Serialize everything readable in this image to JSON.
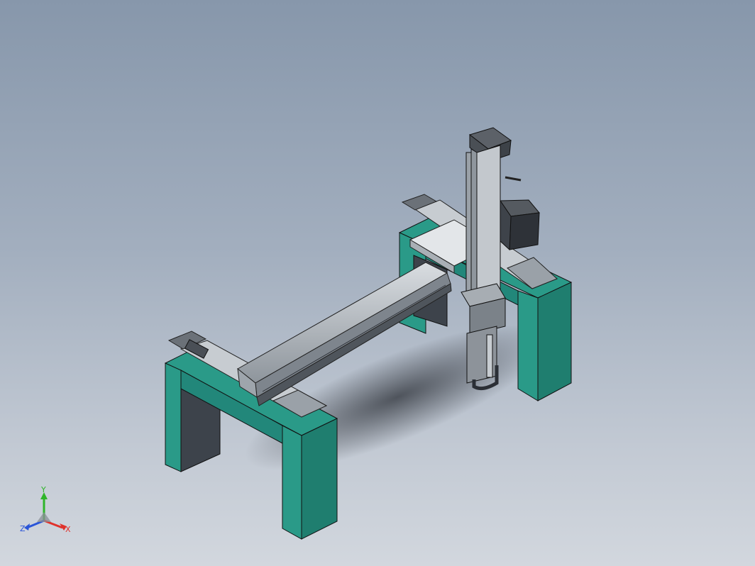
{
  "viewport": {
    "background_top": "#8797ab",
    "background_bottom": "#d2d7de"
  },
  "colors": {
    "support_face": "#2a9a88",
    "support_face_dark": "#1f7e6f",
    "support_inner": "#3d434b",
    "rail_metal": "#b7bcc2",
    "rail_shadow": "#5b6168",
    "motor_dark": "#2e3238",
    "axis_x": "#e0322b",
    "axis_y": "#2fb52a",
    "axis_z": "#2a55d8"
  },
  "triad": {
    "x_label": "X",
    "y_label": "Y",
    "z_label": "Z"
  },
  "icons": [
    "coordinate-triad-icon"
  ]
}
